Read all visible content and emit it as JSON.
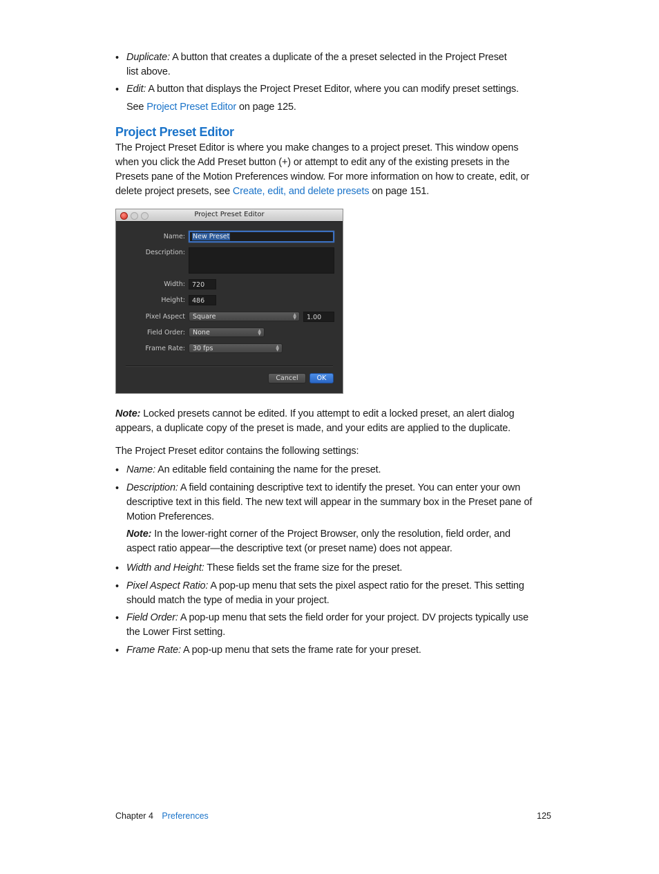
{
  "top_bullets": [
    {
      "term": "Duplicate:",
      "lines": [
        "A button that creates a duplicate of the a preset selected in the Project Preset",
        "list above."
      ]
    },
    {
      "term": "Edit:",
      "lines": [
        "A button that displays the Project Preset Editor, where you can modify preset settings."
      ],
      "see": {
        "prefix": "See ",
        "link": "Project Preset Editor",
        "suffix": " on page 125."
      }
    }
  ],
  "section": {
    "heading": "Project Preset Editor",
    "intro_lines": [
      "The Project Preset Editor is where you make changes to a project preset. This window opens",
      "when you click the Add Preset button (+) or attempt to edit any of the existing presets in the",
      "Presets pane of the Motion Preferences window. For more information on how to create, edit, or"
    ],
    "intro_last": {
      "prefix": "delete project presets, see ",
      "link": "Create, edit, and delete presets",
      "suffix": " on page 151."
    }
  },
  "window": {
    "title": "Project Preset Editor",
    "name_label": "Name:",
    "name_value": "New Preset",
    "description_label": "Description:",
    "description_value": "",
    "width_label": "Width:",
    "width_value": "720",
    "height_label": "Height:",
    "height_value": "486",
    "pixel_aspect_label": "Pixel Aspect",
    "pixel_aspect_value": "Square",
    "pixel_aspect_ratio": "1.00",
    "field_order_label": "Field Order:",
    "field_order_value": "None",
    "frame_rate_label": "Frame Rate:",
    "frame_rate_value": "30 fps",
    "cancel_label": "Cancel",
    "ok_label": "OK"
  },
  "note1": {
    "label": "Note:",
    "line1": " Locked presets cannot be edited. If you attempt to edit a locked preset, an alert dialog",
    "line2": "appears, a duplicate copy of the preset is made, and your edits are applied to the duplicate."
  },
  "settings_intro": "The Project Preset editor contains the following settings:",
  "settings": [
    {
      "term": "Name:",
      "lines": [
        "An editable field containing the name for the preset."
      ]
    },
    {
      "term": "Description:",
      "lines": [
        "A field containing descriptive text to identify the preset. You can enter your own",
        "descriptive text in this field. The new text will appear in the summary box in the Preset pane of",
        "Motion Preferences."
      ]
    },
    {
      "term": "Width and Height:",
      "lines": [
        "These fields set the frame size for the preset."
      ]
    },
    {
      "term": "Pixel Aspect Ratio:",
      "lines": [
        "A pop-up menu that sets the pixel aspect ratio for the preset. This setting",
        "should match the type of media in your project."
      ]
    },
    {
      "term": "Field Order:",
      "lines": [
        "A pop-up menu that sets the field order for your project. DV projects typically use",
        "the Lower First setting."
      ]
    },
    {
      "term": "Frame Rate:",
      "lines": [
        "A pop-up menu that sets the frame rate for your preset."
      ]
    }
  ],
  "note2": {
    "label": "Note:",
    "line1": " In the lower-right corner of the Project Browser, only the resolution, field order, and",
    "line2": "aspect ratio appear—the descriptive text (or preset name) does not appear."
  },
  "bullet_char": "•",
  "footer": {
    "chapter": "Chapter 4",
    "chapter_title": "Preferences",
    "page_number": "125"
  }
}
